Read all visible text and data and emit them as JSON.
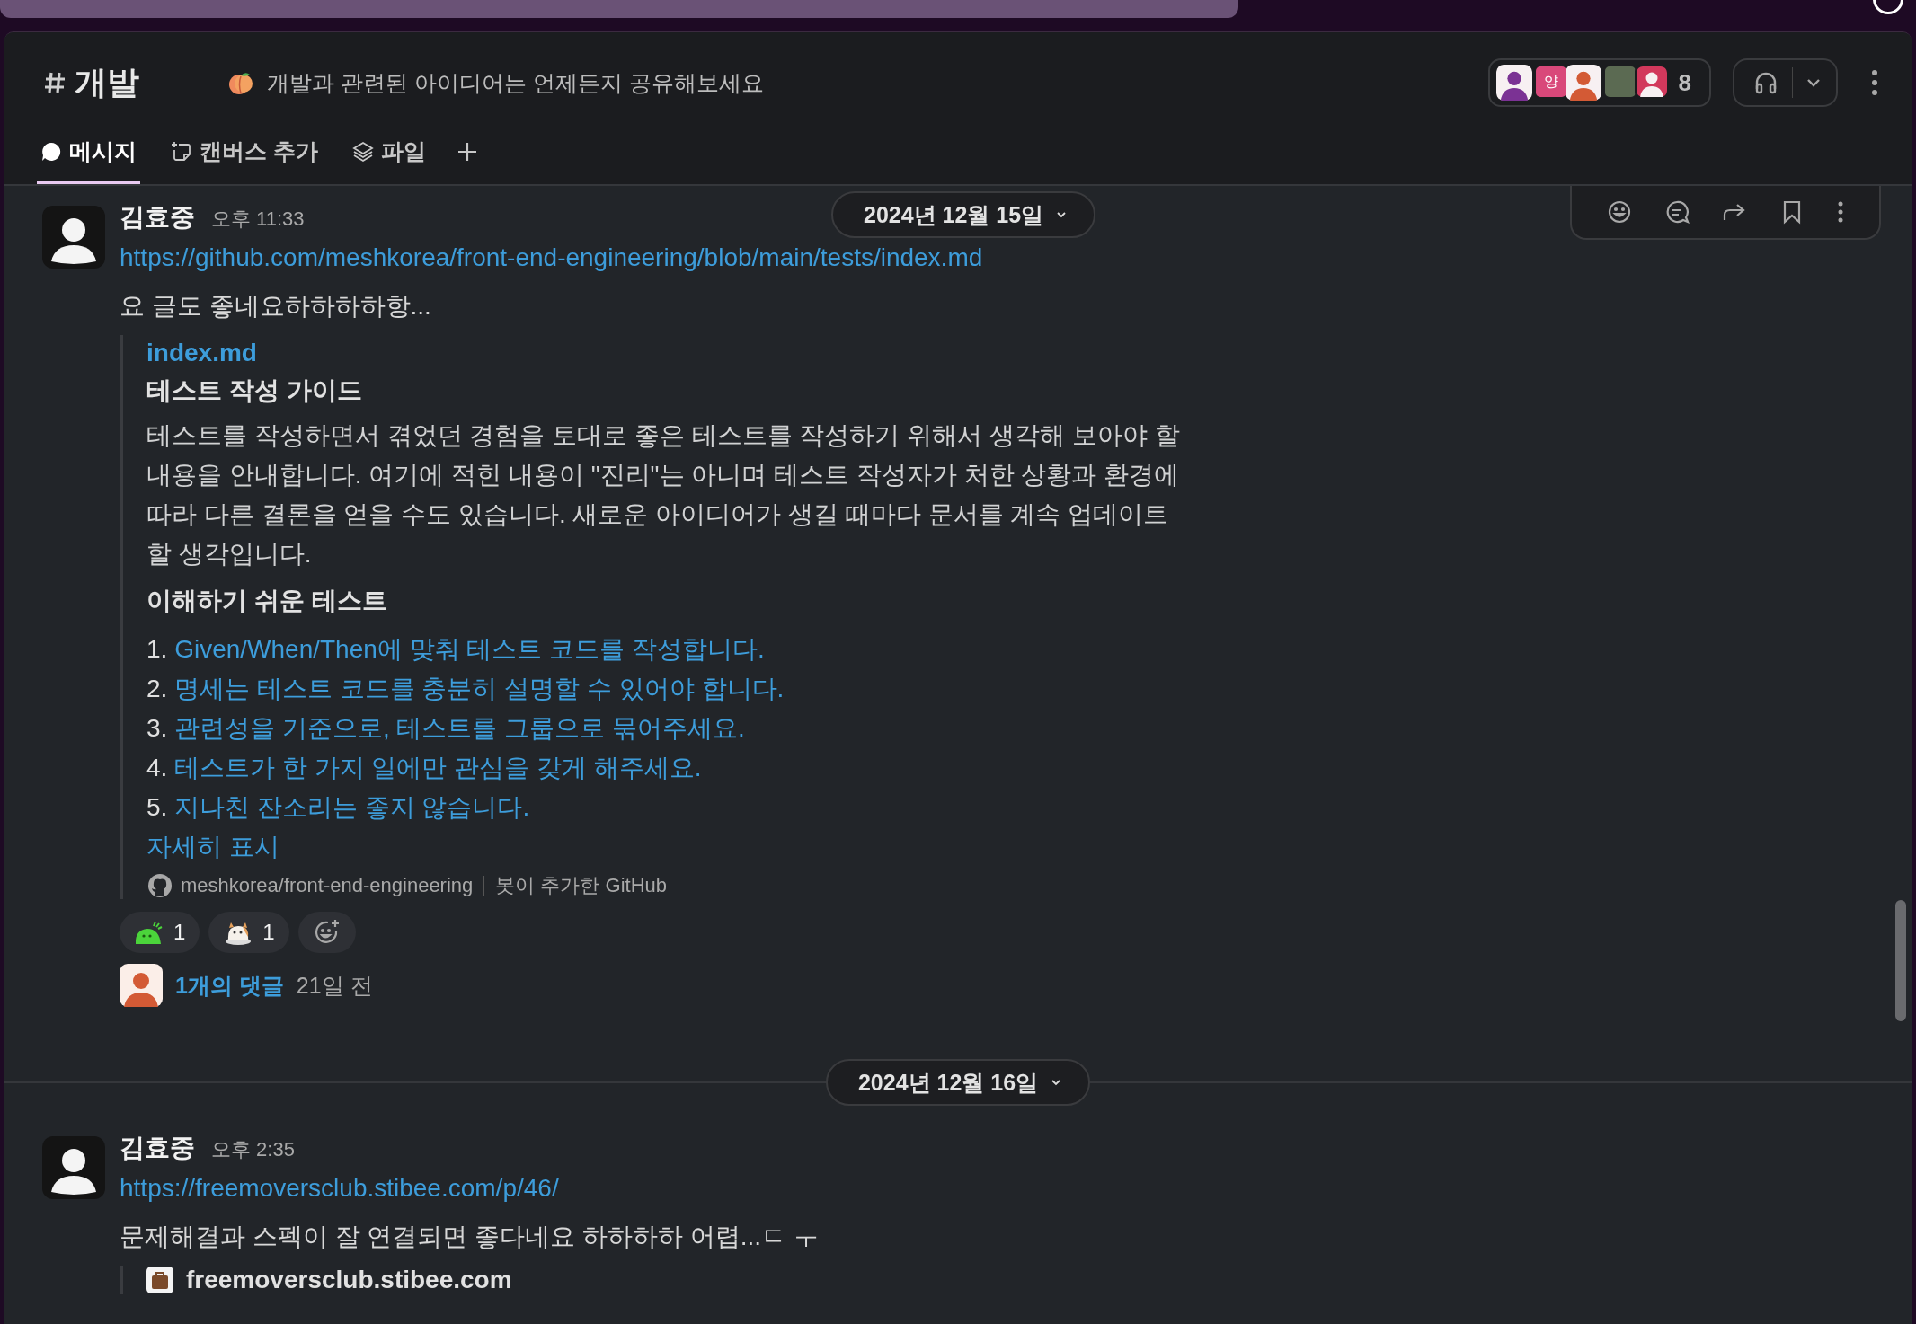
{
  "channel": {
    "name": "개발",
    "topic": "개발과 관련된 아이디어는 언제든지 공유해보세요"
  },
  "members": {
    "count": "8",
    "avatars": [
      {
        "kind": "person",
        "color": "#7b3294"
      },
      {
        "kind": "letter",
        "color": "#d9487a",
        "text": "양"
      },
      {
        "kind": "person",
        "color": "#d35a35"
      },
      {
        "kind": "photo",
        "color": "#5b6a52"
      },
      {
        "kind": "person-inverse",
        "color": "#d2385c"
      }
    ]
  },
  "tabs": [
    {
      "label": "메시지",
      "kind": "bubble",
      "selected": true
    },
    {
      "label": "캔버스 추가",
      "kind": "canvas",
      "selected": false
    },
    {
      "label": "파일",
      "kind": "layers",
      "selected": false
    }
  ],
  "messages": [
    {
      "date": "2024년 12월 15일",
      "author": "김효중",
      "time": "오후 11:33",
      "link": "https://github.com/meshkorea/front-end-engineering/blob/main/tests/index.md",
      "text": "요 글도 좋네요하하하하항...",
      "embed": {
        "kind": "github",
        "title": "index.md",
        "heading": "테스트 작성 가이드",
        "paragraph": "테스트를 작성하면서 겪었던 경험을 토대로 좋은 테스트를 작성하기 위해서 생각해 보아야 할 내용을 안내합니다. 여기에 적힌 내용이 \"진리\"는 아니며 테스트 작성자가 처한 상황과 환경에 따라 다른 결론을 얻을 수도 있습니다. 새로운 아이디어가 생길 때마다 문서를 계속 업데이트 할 생각입니다.",
        "subheading": "이해하기 쉬운 테스트",
        "list": [
          {
            "number": "1.",
            "text": "Given/When/Then에 맞춰 테스트 코드를 작성합니다."
          },
          {
            "number": "2.",
            "text": "명세는 테스트 코드를 충분히 설명할 수 있어야 합니다."
          },
          {
            "number": "3.",
            "text": "관련성을 기준으로, 테스트를 그룹으로 묶어주세요."
          },
          {
            "number": "4.",
            "text": "테스트가 한 가지 일에만 관심을 갖게 해주세요."
          },
          {
            "number": "5.",
            "text": "지나친 잔소리는 좋지 않습니다."
          }
        ],
        "more": "자세히 표시",
        "source": "meshkorea/front-end-engineering",
        "source_note": "봇이 추가한 GitHub"
      },
      "reactions": [
        {
          "kind": "blob",
          "count": "1"
        },
        {
          "kind": "cat",
          "count": "1"
        }
      ],
      "thread": {
        "replies": "1개의 댓글",
        "ago": "21일 전"
      }
    },
    {
      "date": "2024년 12월 16일",
      "author": "김효중",
      "time": "오후 2:35",
      "link": "https://freemoversclub.stibee.com/p/46/",
      "text": "문제해결과 스펙이 잘 연결되면 좋다네요 하하하하 어렵...ㄷ ㅜ",
      "embed": {
        "kind": "site",
        "title": "freemoversclub.stibee.com"
      }
    }
  ]
}
